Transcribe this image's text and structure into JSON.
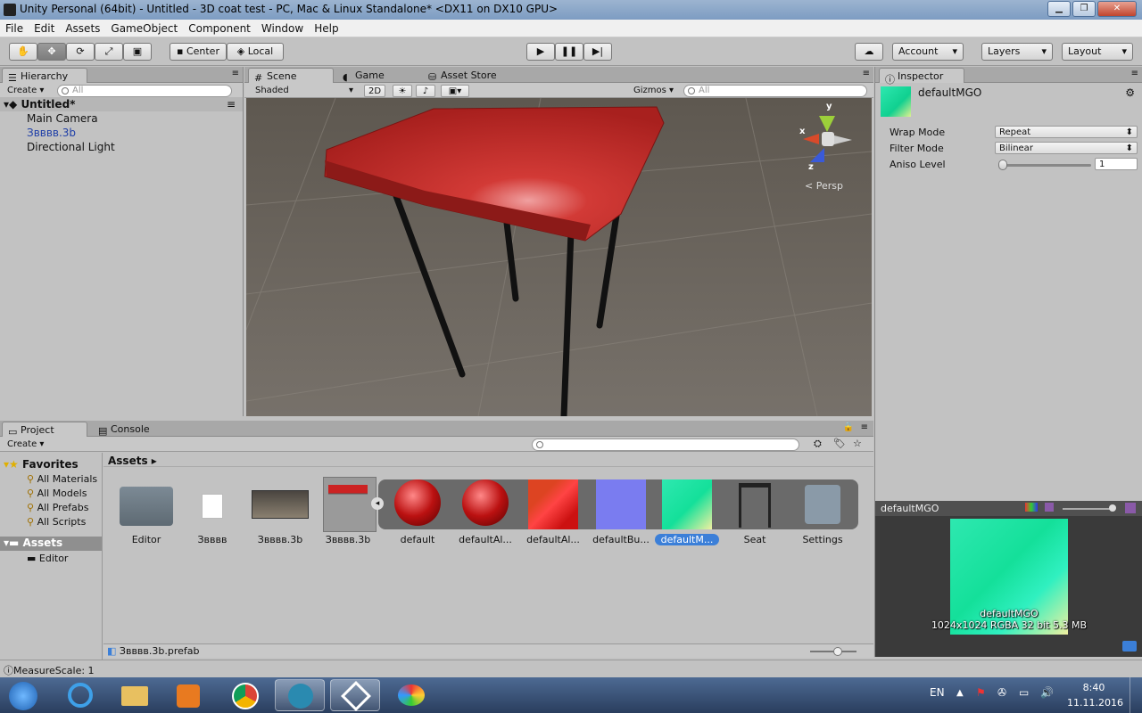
{
  "window": {
    "title": "Unity Personal (64bit) - Untitled - 3D coat test - PC, Mac & Linux Standalone* <DX11 on DX10 GPU>"
  },
  "menu": [
    "File",
    "Edit",
    "Assets",
    "GameObject",
    "Component",
    "Window",
    "Help"
  ],
  "toolbar": {
    "pivot": "Center",
    "space": "Local",
    "account": "Account",
    "layers": "Layers",
    "layout": "Layout"
  },
  "hierarchy": {
    "tab": "Hierarchy",
    "create": "Create",
    "search_placeholder": "All",
    "scene": "Untitled*",
    "items": [
      "Main Camera",
      "Звввв.3b",
      "Directional Light"
    ]
  },
  "scene_view": {
    "tabs": [
      "Scene",
      "Game",
      "Asset Store"
    ],
    "shading": "Shaded",
    "mode_2d": "2D",
    "gizmos": "Gizmos",
    "search_placeholder": "All",
    "persp": "Persp",
    "axis": {
      "x": "x",
      "y": "y",
      "z": "z"
    }
  },
  "inspector": {
    "tab": "Inspector",
    "asset_name": "defaultMGO",
    "props": [
      {
        "label": "Wrap Mode",
        "value": "Repeat"
      },
      {
        "label": "Filter Mode",
        "value": "Bilinear"
      }
    ],
    "aniso": {
      "label": "Aniso Level",
      "value": "1",
      "level": 0.0
    }
  },
  "preview": {
    "title": "defaultMGO",
    "name": "defaultMGO",
    "info": "1024x1024  RGBA 32 bit  5.3 MB"
  },
  "project": {
    "tabs": [
      "Project",
      "Console"
    ],
    "create": "Create",
    "favorites": "Favorites",
    "fav_items": [
      "All Materials",
      "All Models",
      "All Prefabs",
      "All Scripts"
    ],
    "assets_root": "Assets",
    "asset_folders": [
      "Editor"
    ],
    "breadcrumb": "Assets",
    "assets": [
      "Editor",
      "Звввв",
      "Звввв.3b",
      "Звввв.3b",
      "default",
      "defaultAl...",
      "defaultAl...",
      "defaultBu...",
      "defaultM...",
      "Seat",
      "Settings"
    ],
    "selected_path": "Звввв.3b.prefab"
  },
  "status": "MeasureScale: 1",
  "taskbar": {
    "lang": "EN",
    "time": "8:40",
    "date": "11.11.2016"
  }
}
